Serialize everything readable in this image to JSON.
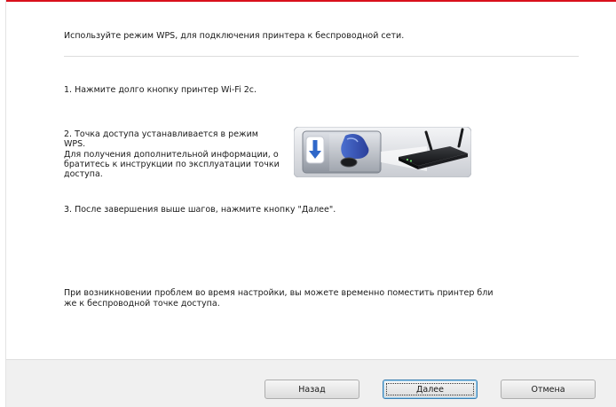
{
  "dialog": {
    "instruction": "Используйте режим WPS, для подключения принтера к беспроводной сети.",
    "step1": "1. Нажмите долго кнопку принтер Wi-Fi 2c.",
    "step2_lines": [
      "2. Точка доступа устанавливается в режим",
      "WPS.",
      "Для получения дополнительной информации, о",
      "братитесь к инструкции по эксплуатации точки",
      "доступа."
    ],
    "step3": "3. После завершения выше шагов, нажмите кнопку \"Далее\".",
    "note_lines": [
      "При возникновении проблем во время настройки, вы можете временно поместить принтер бли",
      "же к беспроводной точке доступа."
    ]
  },
  "buttons": {
    "back": "Назад",
    "next": "Далее",
    "cancel": "Отмена"
  },
  "colors": {
    "accent": "#d9101c",
    "wps_button_blue": "#3a6cc0",
    "footer_bg": "#f0f0f0"
  },
  "icons": {
    "illustration": "wps-button-press-and-router",
    "arrow": "arrow-down-icon",
    "finger": "finger-press-icon",
    "router": "wireless-router-icon"
  }
}
